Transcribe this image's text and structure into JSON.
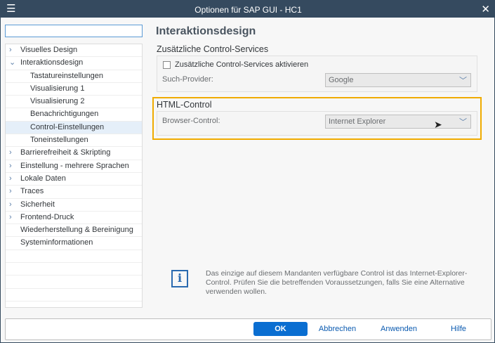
{
  "window": {
    "title": "Optionen für SAP GUI - HC1"
  },
  "search": {
    "value": ""
  },
  "tree": [
    {
      "label": "Visuelles Design",
      "level": 0,
      "arrow": "›"
    },
    {
      "label": "Interaktionsdesign",
      "level": 0,
      "arrow": "⌄"
    },
    {
      "label": "Tastatureinstellungen",
      "level": 1
    },
    {
      "label": "Visualisierung 1",
      "level": 1
    },
    {
      "label": "Visualisierung 2",
      "level": 1
    },
    {
      "label": "Benachrichtigungen",
      "level": 1
    },
    {
      "label": "Control-Einstellungen",
      "level": 1,
      "selected": true
    },
    {
      "label": "Toneinstellungen",
      "level": 1
    },
    {
      "label": "Barrierefreiheit & Skripting",
      "level": 0,
      "arrow": "›"
    },
    {
      "label": "Einstellung - mehrere Sprachen",
      "level": 0,
      "arrow": "›"
    },
    {
      "label": "Lokale Daten",
      "level": 0,
      "arrow": "›"
    },
    {
      "label": "Traces",
      "level": 0,
      "arrow": "›"
    },
    {
      "label": "Sicherheit",
      "level": 0,
      "arrow": "›"
    },
    {
      "label": "Frontend-Druck",
      "level": 0,
      "arrow": "›"
    },
    {
      "label": "Wiederherstellung & Bereinigung",
      "level": 0
    },
    {
      "label": "Systeminformationen",
      "level": 0
    }
  ],
  "main": {
    "heading": "Interaktionsdesign",
    "services": {
      "title": "Zusätzliche Control-Services",
      "checkbox_label": "Zusätzliche Control-Services aktivieren",
      "checked": false,
      "provider_label": "Such-Provider:",
      "provider_value": "Google"
    },
    "html_control": {
      "title": "HTML-Control",
      "browser_label": "Browser-Control:",
      "browser_value": "Internet Explorer"
    },
    "info": "Das einzige auf diesem Mandanten verfügbare Control ist das Internet-Explorer-Control. Prüfen Sie die betreffenden Voraussetzungen, falls Sie eine Alternative verwenden wollen."
  },
  "footer": {
    "ok": "OK",
    "cancel": "Abbrechen",
    "apply": "Anwenden",
    "help": "Hilfe"
  },
  "colors": {
    "titlebar": "#354a5f",
    "highlight": "#f0ab00",
    "primary": "#0a6ed1"
  }
}
